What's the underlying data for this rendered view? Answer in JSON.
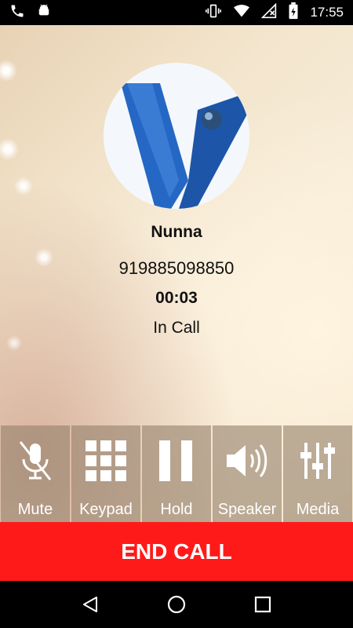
{
  "status_bar": {
    "time": "17:55",
    "icons": [
      "phone-icon",
      "android-icon",
      "vibrate-icon",
      "wifi-icon",
      "signal-off-icon",
      "battery-icon"
    ]
  },
  "call": {
    "contact_name": "Nunna",
    "phone_number": "919885098850",
    "duration": "00:03",
    "status": "In Call"
  },
  "controls": [
    {
      "label": "Mute",
      "icon": "mic-off-icon"
    },
    {
      "label": "Keypad",
      "icon": "keypad-icon"
    },
    {
      "label": "Hold",
      "icon": "pause-icon"
    },
    {
      "label": "Speaker",
      "icon": "speaker-icon"
    },
    {
      "label": "Media",
      "icon": "equalizer-icon"
    }
  ],
  "end_call_label": "END CALL",
  "nav": [
    "back-icon",
    "home-icon",
    "recents-icon"
  ],
  "colors": {
    "end_call": "#ff1a1a",
    "control_bg": "#96826e",
    "avatar_logo": "#1f5fb0"
  }
}
